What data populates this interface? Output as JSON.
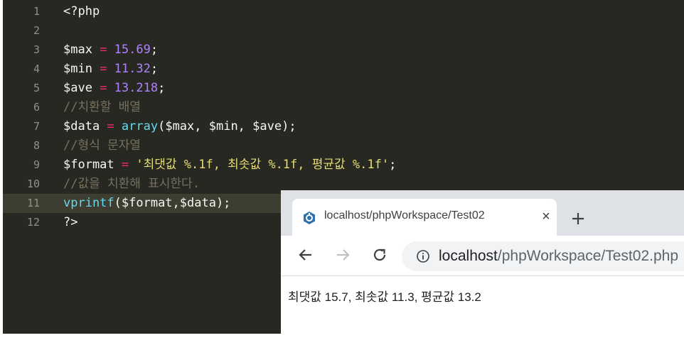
{
  "editor": {
    "lines": [
      {
        "num": "1",
        "tokens": [
          {
            "t": "<?php",
            "c": "t-pun"
          }
        ]
      },
      {
        "num": "2",
        "tokens": []
      },
      {
        "num": "3",
        "tokens": [
          {
            "t": "$max",
            "c": "t-var"
          },
          {
            "t": " = ",
            "c": "t-op"
          },
          {
            "t": "15.69",
            "c": "t-num"
          },
          {
            "t": ";",
            "c": "t-pun"
          }
        ]
      },
      {
        "num": "4",
        "tokens": [
          {
            "t": "$min",
            "c": "t-var"
          },
          {
            "t": " = ",
            "c": "t-op"
          },
          {
            "t": "11.32",
            "c": "t-num"
          },
          {
            "t": ";",
            "c": "t-pun"
          }
        ]
      },
      {
        "num": "5",
        "tokens": [
          {
            "t": "$ave",
            "c": "t-var"
          },
          {
            "t": " = ",
            "c": "t-op"
          },
          {
            "t": "13.218",
            "c": "t-num"
          },
          {
            "t": ";",
            "c": "t-pun"
          }
        ]
      },
      {
        "num": "6",
        "tokens": [
          {
            "t": "//치환할 배열",
            "c": "t-com"
          }
        ]
      },
      {
        "num": "7",
        "tokens": [
          {
            "t": "$data",
            "c": "t-var"
          },
          {
            "t": " = ",
            "c": "t-op"
          },
          {
            "t": "array",
            "c": "t-fn"
          },
          {
            "t": "($max, $min, $ave);",
            "c": "t-pun"
          }
        ]
      },
      {
        "num": "8",
        "tokens": [
          {
            "t": "//형식 문자열",
            "c": "t-com"
          }
        ]
      },
      {
        "num": "9",
        "tokens": [
          {
            "t": "$format",
            "c": "t-var"
          },
          {
            "t": " = ",
            "c": "t-op"
          },
          {
            "t": "'최댓값 %.1f, 최솟값 %.1f, 평균값 %.1f'",
            "c": "t-str"
          },
          {
            "t": ";",
            "c": "t-pun"
          }
        ]
      },
      {
        "num": "10",
        "tokens": [
          {
            "t": "//값을 치환해 표시한다.",
            "c": "t-com"
          }
        ]
      },
      {
        "num": "11",
        "tokens": [
          {
            "t": "vprintf",
            "c": "t-fn"
          },
          {
            "t": "($format,$data);",
            "c": "t-pun"
          }
        ],
        "active": true
      },
      {
        "num": "12",
        "tokens": [
          {
            "t": "?>",
            "c": "t-pun"
          }
        ]
      }
    ]
  },
  "browser": {
    "tab_title": "localhost/phpWorkspace/Test02",
    "tab_close": "×",
    "url_host": "localhost",
    "url_path": "/phpWorkspace/Test02.php",
    "page_output": "최댓값 15.7, 최솟값 11.3, 평균값 13.2"
  },
  "colors": {
    "editor_bg": "#272822",
    "keyword": "#f92672",
    "number": "#ae81ff",
    "string": "#e6db74",
    "function": "#66d9ef",
    "comment": "#75715e"
  }
}
